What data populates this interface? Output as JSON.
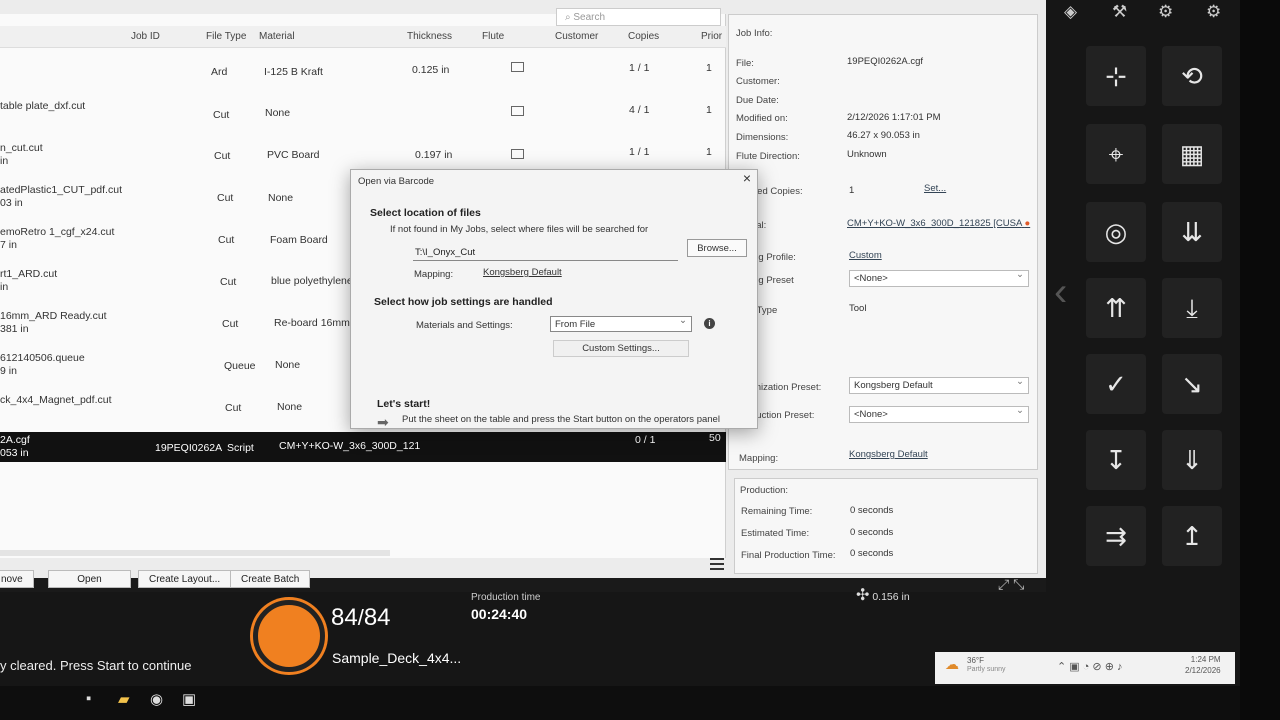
{
  "search": {
    "placeholder": "Search"
  },
  "table": {
    "headers": [
      "Job ID",
      "File Type",
      "Material",
      "Thickness",
      "Flute",
      "Customer",
      "Copies",
      "Prior"
    ],
    "rows": [
      {
        "name1": "",
        "name2": "",
        "filetype": "Ard",
        "material": "I-125 B Kraft",
        "thickness": "0.125 in",
        "copies": "1 / 1",
        "prio": "1"
      },
      {
        "name1": "table plate_dxf.cut",
        "name2": "",
        "filetype": "Cut",
        "material": "None",
        "thickness": "",
        "copies": "4 / 1",
        "prio": "1"
      },
      {
        "name1": "n_cut.cut",
        "name2": "in",
        "filetype": "Cut",
        "material": "PVC Board",
        "thickness": "0.197 in",
        "copies": "1 / 1",
        "prio": "1"
      },
      {
        "name1": "atedPlastic1_CUT_pdf.cut",
        "name2": "03 in",
        "filetype": "Cut",
        "material": "None",
        "thickness": "",
        "copies": "",
        "prio": ""
      },
      {
        "name1": "emoRetro 1_cgf_x24.cut",
        "name2": "7 in",
        "filetype": "Cut",
        "material": "Foam Board",
        "thickness": "",
        "copies": "",
        "prio": ""
      },
      {
        "name1": "rt1_ARD.cut",
        "name2": "in",
        "filetype": "Cut",
        "material": "blue polyethylene",
        "thickness": "",
        "copies": "",
        "prio": ""
      },
      {
        "name1": "16mm_ARD Ready.cut",
        "name2": "381 in",
        "filetype": "Cut",
        "material": "Re-board 16mm",
        "thickness": "",
        "copies": "",
        "prio": ""
      },
      {
        "name1": "612140506.queue",
        "name2": "9 in",
        "filetype": "Queue",
        "material": "None",
        "thickness": "",
        "copies": "",
        "prio": ""
      },
      {
        "name1": "ck_4x4_Magnet_pdf.cut",
        "name2": "",
        "filetype": "Cut",
        "material": "None",
        "thickness": "",
        "copies": "",
        "prio": ""
      }
    ],
    "selected": {
      "name1": "2A.cgf",
      "name2": "053 in",
      "jobid": "19PEQI0262A",
      "filetype": "Script",
      "material": "CM+Y+KO-W_3x6_300D_121",
      "copies": "0 / 1",
      "prio": "50"
    }
  },
  "buttons": {
    "remove": "nove",
    "open": "Open",
    "create_layout": "Create Layout...",
    "create_batch": "Create Batch"
  },
  "info": {
    "title": "Job Info:",
    "file_label": "File:",
    "file": "19PEQI0262A.cgf",
    "customer_label": "Customer:",
    "due_label": "Due Date:",
    "modified_label": "Modified on:",
    "modified": "2/12/2026 1:17:01 PM",
    "dims_label": "Dimensions:",
    "dims": "46.27 x 90.053 in",
    "flute_label": "Flute Direction:",
    "flute": "Unknown",
    "copies_label": "red Copies:",
    "copies": "1",
    "set": "Set...",
    "material_label": "rial:",
    "material": "CM+Y+KO-W_3x6_300D_121825 [CUSA",
    "profile_label": "ing Profile:",
    "profile": "Custom",
    "preset_label": "ing Preset",
    "preset": "<None>",
    "type_label": "r Type",
    "type": "Tool",
    "opt_label": "imization Preset:",
    "opt": "Kongsberg Default",
    "prodp_label": "duction Preset:",
    "prodp": "<None>",
    "mapping_label": "Mapping:",
    "mapping": "Kongsberg Default"
  },
  "production": {
    "title": "Production:",
    "remaining_label": "Remaining Time:",
    "remaining": "0 seconds",
    "estimated_label": "Estimated Time:",
    "estimated": "0 seconds",
    "final_label": "Final Production Time:",
    "final": "0 seconds"
  },
  "dialog": {
    "title": "Open via Barcode",
    "h1": "Select location of files",
    "hint": "If not found in My Jobs, select where files will be searched for",
    "path": "T:\\I_Onyx_Cut",
    "browse": "Browse...",
    "mapping_label": "Mapping:",
    "mapping": "Kongsberg Default",
    "h2": "Select how job settings are handled",
    "mat_label": "Materials and Settings:",
    "mat_value": "From File",
    "custom": "Custom Settings...",
    "h3": "Let's start!",
    "start_msg": "Put the sheet on the table and press the Start button on the operators panel"
  },
  "status": {
    "count": "84",
    "total": "84",
    "job": "Sample_Deck_4x4...",
    "prod_label": "Production time",
    "prod_time": "00:24:40",
    "message": "y cleared. Press Start to continue",
    "thickness": "0.156 in"
  },
  "tray": {
    "temp": "36°F",
    "weather": "Partly sunny",
    "time": "1:24 PM",
    "date": "2/12/2026"
  },
  "colors": {
    "accent": "#f08020",
    "panel": "#161616"
  }
}
